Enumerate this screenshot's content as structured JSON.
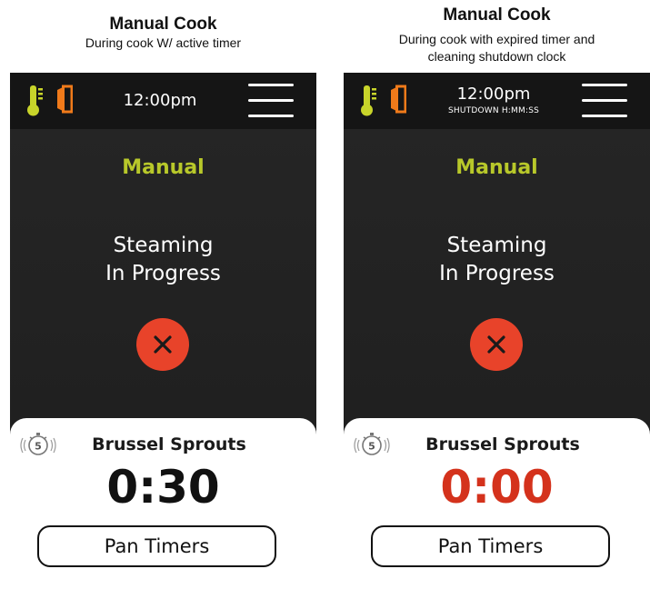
{
  "colors": {
    "accent_mode": "#b8c82a",
    "thermo_icon": "#c8d42a",
    "door_icon": "#f07a1a",
    "cancel_button": "#e8432a",
    "expired_timer": "#d4321c"
  },
  "screens": [
    {
      "caption_title": "Manual Cook",
      "caption_subtitle": "During cook W/ active timer",
      "clock": "12:00pm",
      "mode": "Manual",
      "status_line1": "Steaming",
      "status_line2": "In Progress",
      "timer_badge": "5",
      "item_name": "Brussel Sprouts",
      "countdown": "0:30",
      "pan_button": "Pan Timers"
    },
    {
      "caption_title": "Manual Cook",
      "caption_subtitle_line1": "During cook with expired timer and",
      "caption_subtitle_line2": "cleaning shutdown clock",
      "clock": "12:00pm",
      "shutdown": "SHUTDOWN H:MM:SS",
      "mode": "Manual",
      "status_line1": "Steaming",
      "status_line2": "In Progress",
      "timer_badge": "5",
      "item_name": "Brussel Sprouts",
      "countdown": "0:00",
      "pan_button": "Pan Timers"
    }
  ]
}
